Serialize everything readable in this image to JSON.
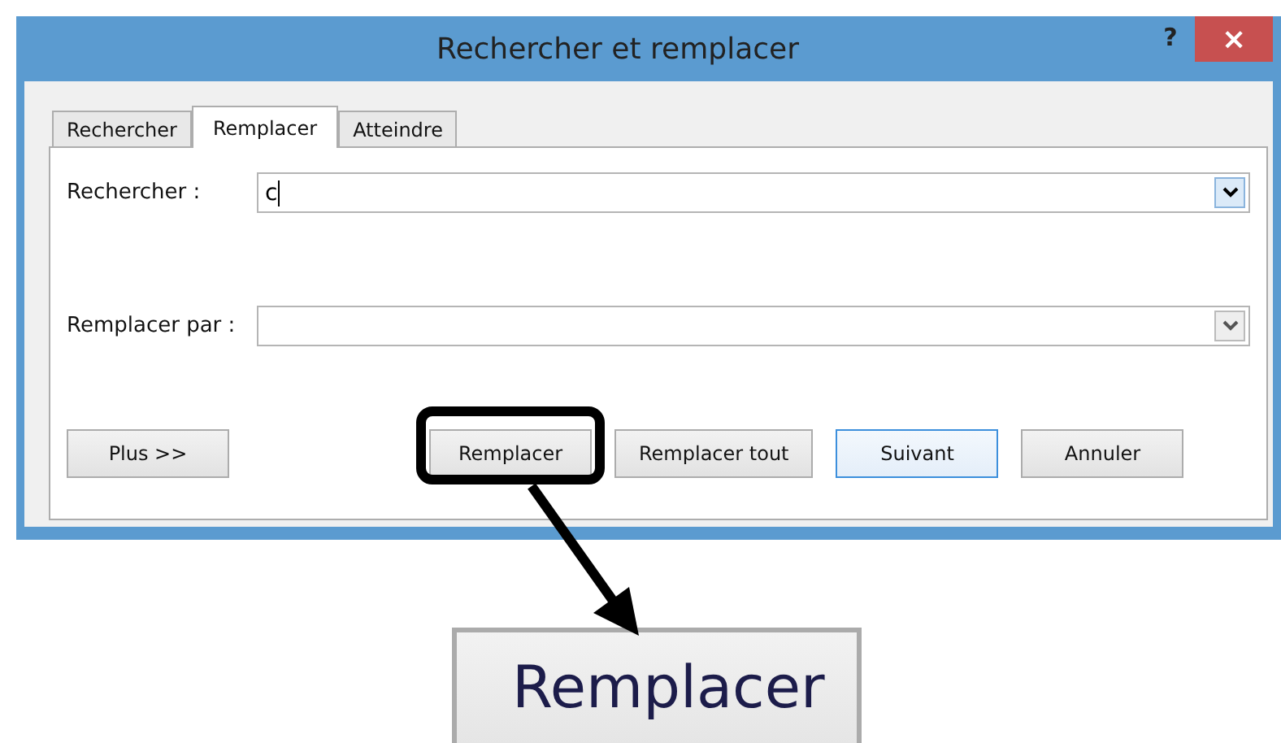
{
  "window": {
    "title": "Rechercher et remplacer",
    "help": "?",
    "close": "×"
  },
  "tabs": [
    {
      "label": "Rechercher",
      "selected": false
    },
    {
      "label": "Remplacer",
      "selected": true
    },
    {
      "label": "Atteindre",
      "selected": false
    }
  ],
  "fields": [
    {
      "label": "Rechercher :",
      "value": "c",
      "focused": true
    },
    {
      "label": "Remplacer par :",
      "focused": false
    }
  ],
  "buttons": [
    {
      "label": "Plus >>",
      "default": false,
      "highlighted": false
    },
    {
      "label": "Remplacer",
      "default": false,
      "highlighted": true
    },
    {
      "label": "Remplacer tout",
      "default": false,
      "highlighted": false
    },
    {
      "label": "Suivant",
      "default": true,
      "highlighted": false
    },
    {
      "label": "Annuler",
      "default": false,
      "highlighted": false
    }
  ],
  "magnified_button": {
    "label": "Remplacer"
  }
}
